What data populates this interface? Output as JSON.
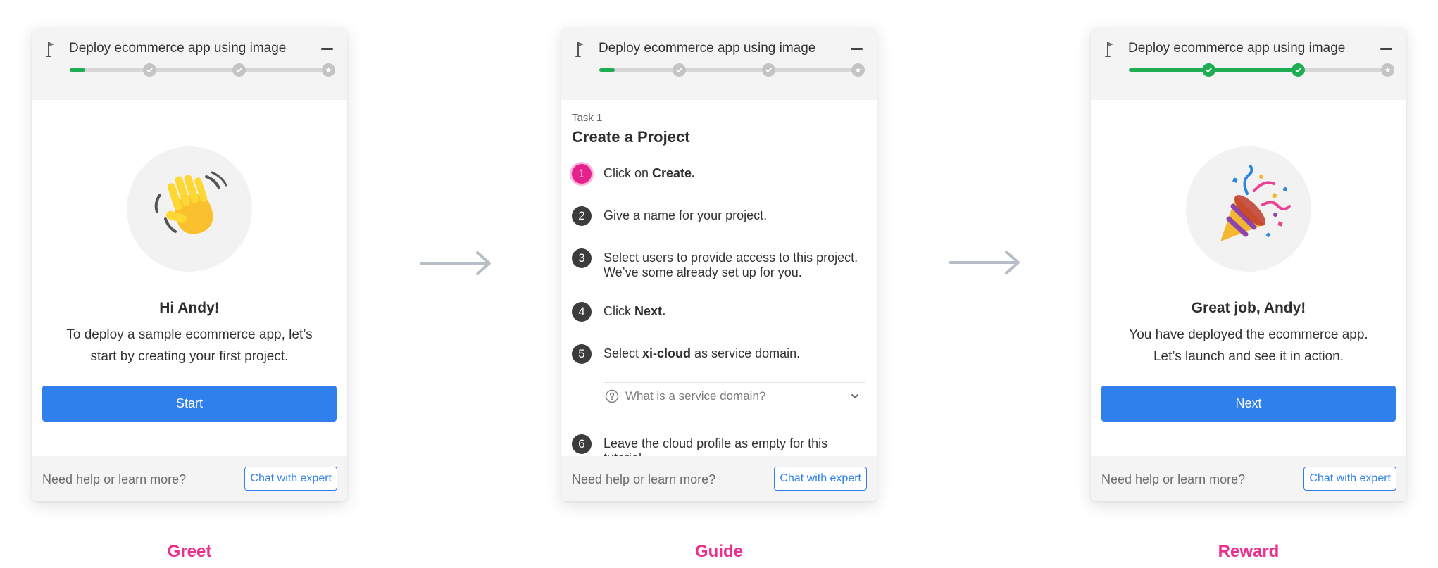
{
  "colors": {
    "accent": "#2f80ed",
    "progress_done": "#1fad54",
    "progress_track": "#d6d6d6",
    "active_step": "#e4208d",
    "stage_label": "#ec2f8e"
  },
  "panels": [
    {
      "title": "Deploy ecommerce app using image",
      "progress": {
        "completed_checkpoints": 0,
        "total_checkpoints": 3,
        "fill_fraction": 0.04
      },
      "hero_icon": "waving-hand-emoji",
      "heading": "Hi Andy!",
      "body_line1": "To deploy a sample ecommerce app, let’s",
      "body_line2": "start by creating your first project.",
      "button_label": "Start",
      "footer_text": "Need help or learn more?",
      "chat_label": "Chat with expert"
    },
    {
      "title": "Deploy ecommerce app using image",
      "progress": {
        "completed_checkpoints": 0,
        "total_checkpoints": 3,
        "fill_fraction": 0.04
      },
      "task_label": "Task 1",
      "task_title": "Create a Project",
      "steps": [
        {
          "num": "1",
          "before": "Click on ",
          "bold": "Create.",
          "after": ""
        },
        {
          "num": "2",
          "before": "Give a name for your project.",
          "bold": "",
          "after": ""
        },
        {
          "num": "3",
          "before": "Select users to provide access to this project. We’ve some already set up for you.",
          "bold": "",
          "after": ""
        },
        {
          "num": "4",
          "before": "Click ",
          "bold": "Next.",
          "after": ""
        },
        {
          "num": "5",
          "before": "Select ",
          "bold": "xi-cloud",
          "after": " as service domain."
        },
        {
          "num": "6",
          "before": "Leave the cloud profile as empty for this tutorial.",
          "bold": "",
          "after": ""
        }
      ],
      "help_question": "What is a service domain?",
      "footer_text": "Need help or learn more?",
      "chat_label": "Chat with expert"
    },
    {
      "title": "Deploy ecommerce app using image",
      "progress": {
        "completed_checkpoints": 2,
        "total_checkpoints": 3,
        "fill_fraction": 0.67
      },
      "hero_icon": "party-popper-emoji",
      "heading": "Great job, Andy!",
      "body_line1": "You have deployed the ecommerce app.",
      "body_line2": "Let’s launch and see it in action.",
      "button_label": "Next",
      "footer_text": "Need help or learn more?",
      "chat_label": "Chat with expert"
    }
  ],
  "stage_labels": [
    "Greet",
    "Guide",
    "Reward"
  ]
}
